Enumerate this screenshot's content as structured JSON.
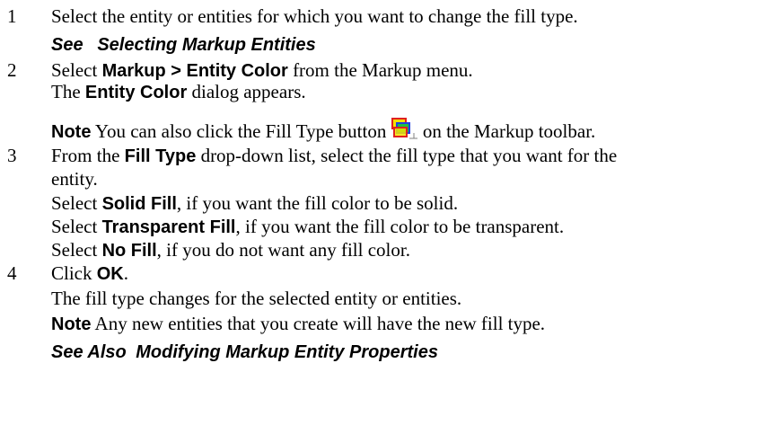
{
  "steps": [
    {
      "number": "1",
      "text": "Select the entity or entities for which you want to change the fill type.",
      "see_prefix": "See",
      "see_link": "Selecting Markup Entities"
    },
    {
      "number": "2",
      "line1_pre": "Select ",
      "line1_bold": "Markup > Entity Color",
      "line1_post": " from the Markup menu.",
      "line2_pre": "The ",
      "line2_bold": "Entity Color",
      "line2_post": " dialog appears.",
      "note_label": "Note",
      "note_pre": "  You can also click the Fill Type button ",
      "note_icon": "fill-type-icon",
      "note_post": " on the Markup toolbar."
    },
    {
      "number": "3",
      "line1_pre": "From the ",
      "line1_bold": "Fill Type",
      "line1_post": " drop-down list, select the fill type that you want for the",
      "line2": "entity.",
      "options": [
        {
          "pre": "Select ",
          "bold": "Solid Fill",
          "post": ", if you want the fill color to be solid."
        },
        {
          "pre": "Select ",
          "bold": "Transparent Fill",
          "post": ", if you want the fill color to be transparent."
        },
        {
          "pre": "Select ",
          "bold": "No Fill",
          "post": ", if you do not want any fill color."
        }
      ]
    },
    {
      "number": "4",
      "line1_pre": "Click ",
      "line1_bold": "OK",
      "line1_post": ".",
      "line2": "The fill type changes for the selected entity or entities.",
      "note_label": "Note",
      "note_text": "  Any new entities that you create will have the new fill type."
    }
  ],
  "see_also": {
    "prefix": "See Also",
    "link": "Modifying Markup Entity Properties"
  },
  "colors": {
    "icon_red": "#e02020",
    "icon_yellow": "#f4e000",
    "icon_blue": "#2040e0",
    "icon_green": "#20c040"
  }
}
